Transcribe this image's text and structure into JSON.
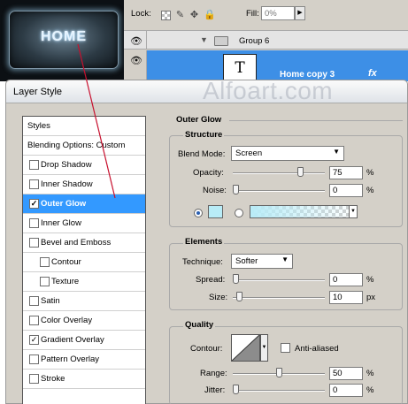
{
  "preview": {
    "button_text": "HOME"
  },
  "layers": {
    "lock_label": "Lock:",
    "fill_label": "Fill:",
    "fill_value": "0%",
    "group_name": "Group 6",
    "layer_name": "Home copy 3",
    "fx": "fx",
    "thumb_text": "T"
  },
  "dialog": {
    "title": "Layer Style",
    "watermark": "Alfoart.com"
  },
  "style_list": {
    "header": "Styles",
    "blending": "Blending Options: Custom",
    "items": [
      {
        "label": "Drop Shadow",
        "checked": false
      },
      {
        "label": "Inner Shadow",
        "checked": false
      },
      {
        "label": "Outer Glow",
        "checked": true
      },
      {
        "label": "Inner Glow",
        "checked": false
      },
      {
        "label": "Bevel and Emboss",
        "checked": false
      },
      {
        "label": "Contour",
        "checked": false
      },
      {
        "label": "Texture",
        "checked": false
      },
      {
        "label": "Satin",
        "checked": false
      },
      {
        "label": "Color Overlay",
        "checked": false
      },
      {
        "label": "Gradient Overlay",
        "checked": true
      },
      {
        "label": "Pattern Overlay",
        "checked": false
      },
      {
        "label": "Stroke",
        "checked": false
      }
    ]
  },
  "outer_glow": {
    "title": "Outer Glow",
    "structure": {
      "title": "Structure",
      "blend_mode_label": "Blend Mode:",
      "blend_mode_value": "Screen",
      "opacity_label": "Opacity:",
      "opacity_value": "75",
      "opacity_unit": "%",
      "opacity_level": 0.75,
      "noise_label": "Noise:",
      "noise_value": "0",
      "noise_unit": "%",
      "noise_level": 0,
      "glow_color": "#b8ecf7"
    },
    "elements": {
      "title": "Elements",
      "technique_label": "Technique:",
      "technique_value": "Softer",
      "spread_label": "Spread:",
      "spread_value": "0",
      "spread_unit": "%",
      "spread_level": 0,
      "size_label": "Size:",
      "size_value": "10",
      "size_unit": "px",
      "size_level": 0.04
    },
    "quality": {
      "title": "Quality",
      "contour_label": "Contour:",
      "anti_aliased_label": "Anti-aliased",
      "anti_aliased_checked": false,
      "range_label": "Range:",
      "range_value": "50",
      "range_unit": "%",
      "range_level": 0.5,
      "jitter_label": "Jitter:",
      "jitter_value": "0",
      "jitter_unit": "%",
      "jitter_level": 0
    }
  },
  "colors": {
    "selection": "#3399ff",
    "layer_selection": "#3d8fe6",
    "annotation_line": "#c8102e"
  }
}
